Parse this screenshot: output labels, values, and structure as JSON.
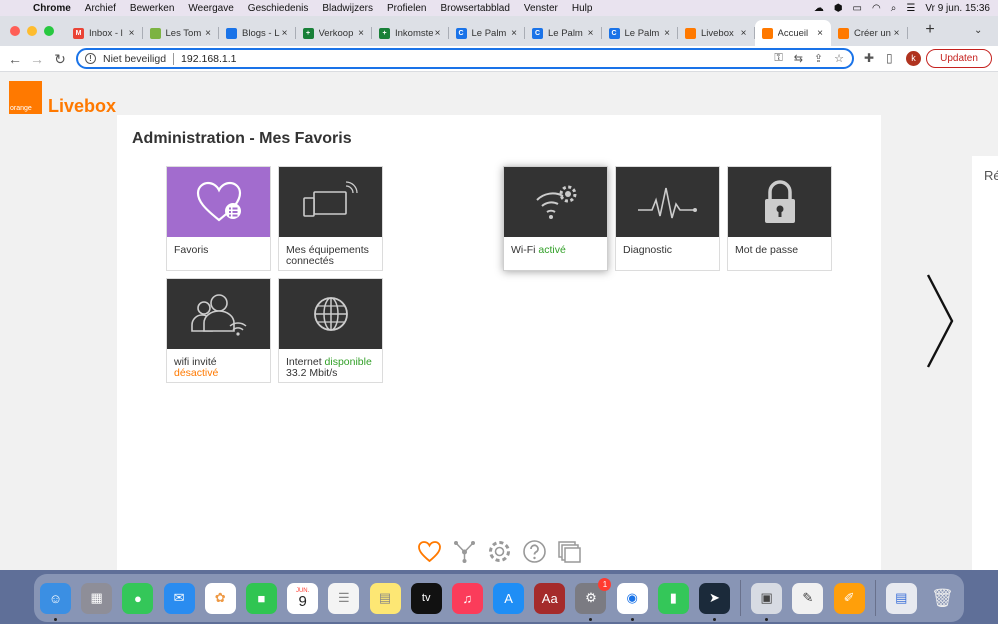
{
  "menubar": {
    "items": [
      "Chrome",
      "Archief",
      "Bewerken",
      "Weergave",
      "Geschiedenis",
      "Bladwijzers",
      "Profielen",
      "Browsertabblad",
      "Venster",
      "Hulp"
    ],
    "clock": "Vr 9 jun.  15:36"
  },
  "browser": {
    "tabs": [
      {
        "label": "Inbox - l",
        "fav_color": "#ea4335",
        "fav_glyph": "M"
      },
      {
        "label": "Les Tom",
        "fav_color": "#7cb342",
        "fav_glyph": ""
      },
      {
        "label": "Blogs - L",
        "fav_color": "#1a73e8",
        "fav_glyph": ""
      },
      {
        "label": "Verkoop",
        "fav_color": "#188038",
        "fav_glyph": "+"
      },
      {
        "label": "Inkomste",
        "fav_color": "#188038",
        "fav_glyph": "+"
      },
      {
        "label": "Le Palm",
        "fav_color": "#1a73e8",
        "fav_glyph": "C"
      },
      {
        "label": "Le Palm",
        "fav_color": "#1a73e8",
        "fav_glyph": "C"
      },
      {
        "label": "Le Palm",
        "fav_color": "#1a73e8",
        "fav_glyph": "C"
      },
      {
        "label": "Livebox",
        "fav_color": "#ff7900",
        "fav_glyph": ""
      },
      {
        "label": "Accueil",
        "fav_color": "#ff7900",
        "fav_glyph": ""
      },
      {
        "label": "Créer un",
        "fav_color": "#ff7900",
        "fav_glyph": ""
      }
    ],
    "active_tab": 9,
    "security_label": "Niet beveiligd",
    "url": "192.168.1.1",
    "avatar_letter": "k",
    "update_label": "Updaten"
  },
  "page": {
    "logo_small": "orange",
    "logo_name": "Livebox",
    "title": "Administration - Mes Favoris",
    "tiles": {
      "favoris": {
        "label": "Favoris"
      },
      "equipements": {
        "label": "Mes équipements connectés"
      },
      "wifi": {
        "label": "Wi-Fi",
        "status": "activé"
      },
      "diagnostic": {
        "label": "Diagnostic"
      },
      "password": {
        "label": "Mot de passe"
      },
      "guest": {
        "label": "wifi invité",
        "status": "désactivé"
      },
      "internet": {
        "label": "Internet",
        "status": "disponible",
        "speed": "33.2 Mbit/s"
      }
    },
    "side_card_text": "Ré"
  },
  "colors": {
    "orange": "#ff7900",
    "violet": "#a26cce",
    "tile_dark": "#333333",
    "status_green": "#32a028"
  },
  "dock": {
    "calendar_month": "JUN.",
    "calendar_day": "9",
    "tv_label": "tv",
    "dictionary_label": "Aa",
    "settings_badge": "1"
  }
}
